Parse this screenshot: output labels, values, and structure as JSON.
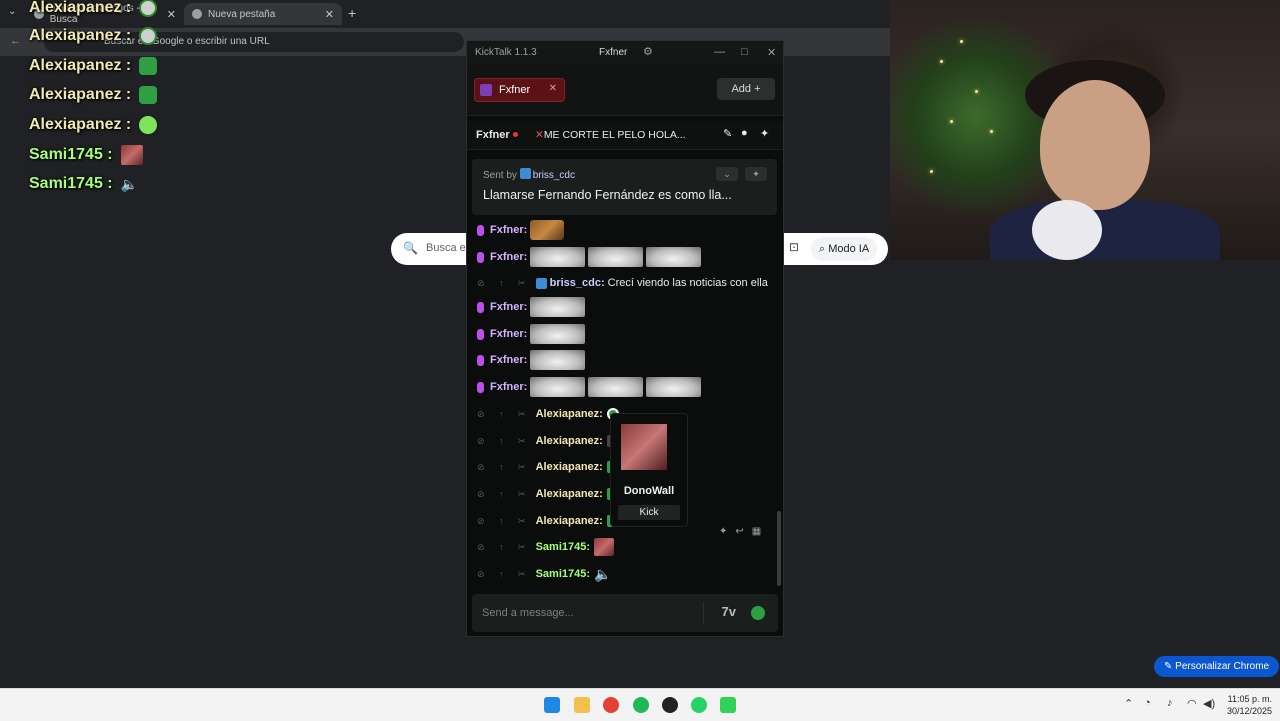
{
  "browser": {
    "tabs": [
      {
        "title": "brainrot psicologos - Busca"
      },
      {
        "title": "Nueva pestaña"
      }
    ],
    "address_placeholder": "Buscar en Google o escribir una URL",
    "new_tab": "+",
    "search_placeholder": "Busca en",
    "ai_mode": "Modo IA",
    "customize": "Personalizar Chrome"
  },
  "overlay_chat": [
    {
      "user": "Alexiapanez :",
      "emote": "face"
    },
    {
      "user": "Alexiapanez :",
      "emote": "face"
    },
    {
      "user": "Alexiapanez :",
      "emote": "green"
    },
    {
      "user": "Alexiapanez :",
      "emote": "green"
    },
    {
      "user": "Alexiapanez :",
      "emote": "lime"
    },
    {
      "user": "Sami1745 :",
      "emote": "brick"
    },
    {
      "user": "Sami1745 :",
      "emote": "speaker"
    }
  ],
  "kicktalk": {
    "app_title": "KickTalk 1.1.3",
    "user": "Fxfner",
    "tab_label": "Fxfner",
    "add_label": "Add",
    "channel": "Fxfner",
    "stream_title": "ME CORTE EL PELO HOLA...",
    "pinned": {
      "sent_by_label": "Sent by",
      "sender": "briss_cdc",
      "message": "Llamarse Fernando Fernández es como lla..."
    },
    "messages": [
      {
        "user": "Fxfner:",
        "type": "cookie"
      },
      {
        "user": "Fxfner:",
        "type": "dog3"
      },
      {
        "user": "briss_cdc:",
        "text": "Crecí viendo las noticias con ella"
      },
      {
        "user": "Fxfner:",
        "type": "dog1"
      },
      {
        "user": "Fxfner:",
        "type": "dog1"
      },
      {
        "user": "Fxfner:",
        "type": "dog1"
      },
      {
        "user": "Fxfner:",
        "type": "dog3"
      },
      {
        "user": "Alexiapanez:",
        "type": "ball"
      },
      {
        "user": "Alexiapanez:"
      },
      {
        "user": "Alexiapanez:"
      },
      {
        "user": "Alexiapanez:"
      },
      {
        "user": "Alexiapanez:"
      },
      {
        "user": "Sami1745:",
        "type": "brick"
      },
      {
        "user": "Sami1745:",
        "type": "speaker"
      }
    ],
    "emote_popup": {
      "name": "DonoWall",
      "source": "Kick"
    },
    "composer_placeholder": "Send a message..."
  },
  "taskbar": {
    "time": "11:05 p. m.",
    "date": "30/12/2025"
  },
  "colors": {
    "kick_green": "#2ea043",
    "tab_red": "#5a1216",
    "fxfner_name": "#d7b3ff",
    "alexia_name": "#f3e6b4",
    "sami_name": "#a6ff7a"
  }
}
